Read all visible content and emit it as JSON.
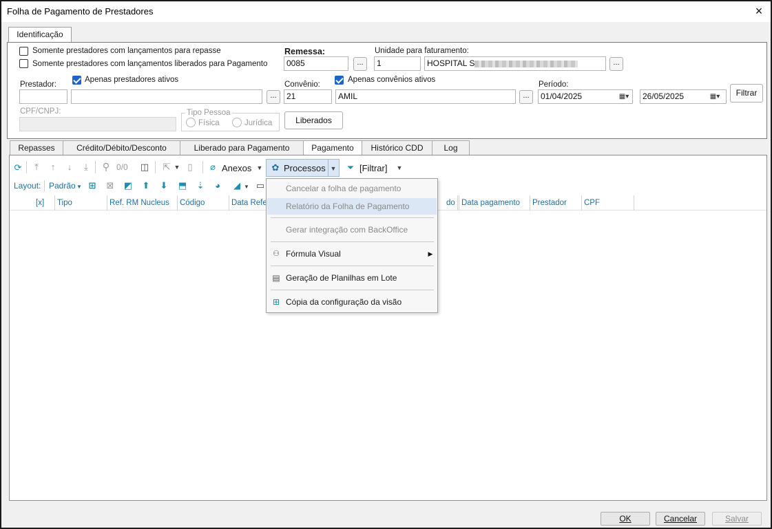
{
  "window": {
    "title": "Folha de Pagamento de Prestadores",
    "close_icon": "×"
  },
  "top_tab": {
    "label": "Identificação"
  },
  "identificacao": {
    "chk_repasse": {
      "label": "Somente prestadores com lançamentos para repasse",
      "checked": false
    },
    "chk_liberados": {
      "label": "Somente prestadores com lançamentos liberados para Pagamento",
      "checked": false
    },
    "remessa_label": "Remessa:",
    "remessa_value": "0085",
    "unidade_label": "Unidade para faturamento:",
    "unidade_code": "1",
    "unidade_name": "HOSPITAL S",
    "prestador_label": "Prestador:",
    "chk_prestadores_ativos": {
      "label": "Apenas prestadores ativos",
      "checked": true
    },
    "convenio_label": "Convênio:",
    "convenio_code": "21",
    "convenio_name": "AMIL",
    "chk_convenios_ativos": {
      "label": "Apenas convênios ativos",
      "checked": true
    },
    "periodo_label": "Período:",
    "periodo_inicio": "01/04/2025",
    "periodo_fim": "26/05/2025",
    "filtrar_button": "Filtrar",
    "cpf_label": "CPF/CNPJ:",
    "tipo_pessoa_label": "Tipo Pessoa",
    "radio_fisica": "Física",
    "radio_juridica": "Jurídica",
    "liberados_button": "Liberados",
    "ellipsis": "..."
  },
  "tabs": [
    {
      "label": "Repasses"
    },
    {
      "label": "Crédito/Débito/Desconto"
    },
    {
      "label": "Liberado para Pagamento"
    },
    {
      "label": "Pagamento"
    },
    {
      "label": "Histórico CDD"
    },
    {
      "label": "Log"
    }
  ],
  "toolbar": {
    "counter": "0/0",
    "anexos": "Anexos",
    "processos": "Processos",
    "filtrar": "[Filtrar]",
    "layout_label": "Layout:",
    "layout_value": "Padrão"
  },
  "grid": {
    "columns": [
      "[x]",
      "Tipo",
      "Ref. RM Nucleus",
      "Código",
      "Data Refer",
      "do",
      "Data pagamento",
      "Prestador",
      "CPF"
    ]
  },
  "menu": {
    "items": [
      {
        "label": "Cancelar a folha de pagamento",
        "disabled": true
      },
      {
        "label": "Relatório da Folha de Pagamento",
        "disabled": true
      },
      {
        "label": "Gerar integração com BackOffice",
        "disabled": true
      },
      {
        "label": "Fórmula Visual",
        "disabled": false
      },
      {
        "label": "Geração de Planilhas em Lote",
        "disabled": false
      },
      {
        "label": "Cópia da configuração da visão",
        "disabled": false
      }
    ]
  },
  "footer": {
    "ok": "OK",
    "cancelar": "Cancelar",
    "salvar": "Salvar"
  }
}
